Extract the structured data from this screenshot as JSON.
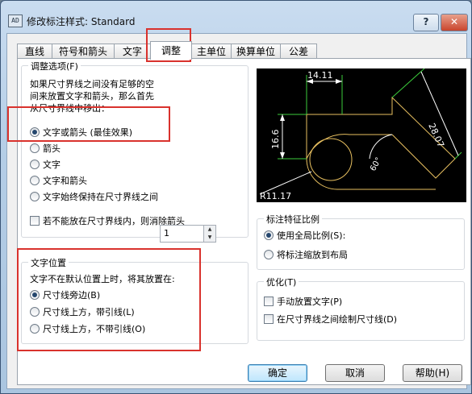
{
  "window": {
    "title": "修改标注样式: Standard",
    "icon_text": "AD",
    "help_label": "?",
    "close_label": "✕"
  },
  "tabs": [
    {
      "label": "直线"
    },
    {
      "label": "符号和箭头"
    },
    {
      "label": "文字"
    },
    {
      "label": "调整",
      "active": true
    },
    {
      "label": "主单位"
    },
    {
      "label": "换算单位"
    },
    {
      "label": "公差"
    }
  ],
  "fit_options": {
    "title": "调整选项(F)",
    "description": [
      "如果尺寸界线之间没有足够的空",
      "间来放置文字和箭头，那么首先",
      "从尺寸界线中移出："
    ],
    "options": [
      {
        "label": "文字或箭头 (最佳效果)",
        "selected": true
      },
      {
        "label": "箭头",
        "selected": false
      },
      {
        "label": "文字",
        "selected": false
      },
      {
        "label": "文字和箭头",
        "selected": false
      },
      {
        "label": "文字始终保持在尺寸界线之间",
        "selected": false
      }
    ],
    "suppress_arrows": {
      "label": "若不能放在尺寸界线内，则消除箭头",
      "checked": false
    }
  },
  "text_placement": {
    "title": "文字位置",
    "description": "文字不在默认位置上时，将其放置在:",
    "options": [
      {
        "label": "尺寸线旁边(B)",
        "selected": true
      },
      {
        "label": "尺寸线上方，带引线(L)",
        "selected": false
      },
      {
        "label": "尺寸线上方，不带引线(O)",
        "selected": false
      }
    ]
  },
  "preview": {
    "dim_top": "14.11",
    "dim_left": "16.6",
    "dim_right": "28.07",
    "dim_angle": "60°",
    "dim_radius": "R11.17",
    "colors": {
      "background": "#000000",
      "geometry": "#e8c060",
      "dimension": "#ffffff",
      "extension": "#3ccd3c"
    }
  },
  "scale": {
    "title": "标注特征比例",
    "options": [
      {
        "label": "使用全局比例(S):",
        "selected": true
      },
      {
        "label": "将标注缩放到布局",
        "selected": false
      }
    ],
    "global_value": "1"
  },
  "finetune": {
    "title": "优化(T)",
    "options": [
      {
        "label": "手动放置文字(P)",
        "checked": false
      },
      {
        "label": "在尺寸界线之间绘制尺寸线(D)",
        "checked": false
      }
    ]
  },
  "buttons": {
    "ok": "确定",
    "cancel": "取消",
    "help": "帮助(H)"
  },
  "highlight_color": "#d9322d"
}
